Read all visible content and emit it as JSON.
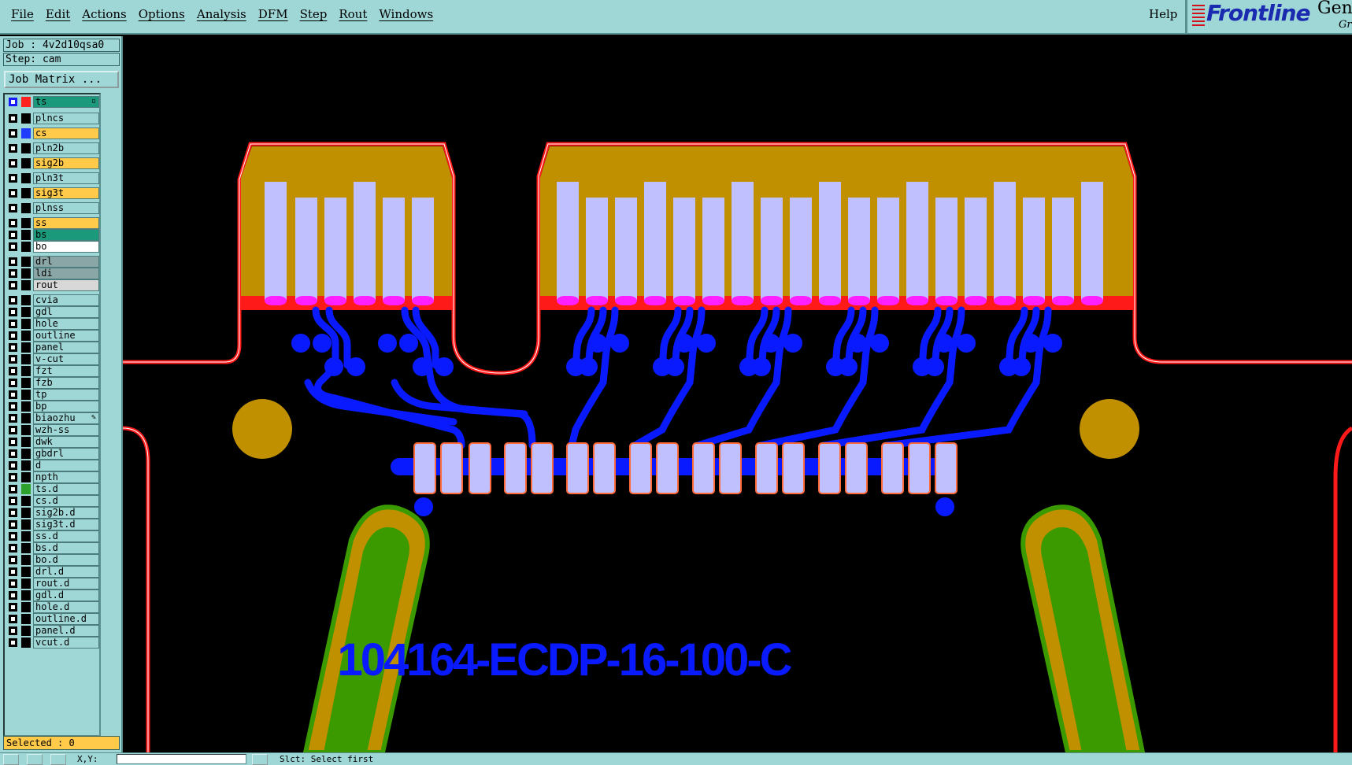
{
  "menubar": {
    "items": [
      "File",
      "Edit",
      "Actions",
      "Options",
      "Analysis",
      "DFM",
      "Step",
      "Rout",
      "Windows"
    ],
    "help": "Help",
    "brand": {
      "name": "Frontline",
      "product": "Gen",
      "sub": "Gr"
    }
  },
  "job": {
    "job_text": "Job : 4v2d10qsa0",
    "step_text": "Step: cam",
    "matrix_label": "Job Matrix ..."
  },
  "layers": [
    {
      "name": "ts",
      "bg": "#1a9a7a",
      "swatch": "#ff2020",
      "active": true,
      "mark": "▫"
    },
    {
      "name": "plncs",
      "bg": "#9fd7d7",
      "swatch": "#000000"
    },
    {
      "name": "cs",
      "bg": "#ffc94a",
      "swatch": "#1f3bff"
    },
    {
      "name": "pln2b",
      "bg": "#9fd7d7",
      "swatch": "#000000"
    },
    {
      "name": "sig2b",
      "bg": "#ffc94a",
      "swatch": "#000000"
    },
    {
      "name": "pln3t",
      "bg": "#9fd7d7",
      "swatch": "#000000"
    },
    {
      "name": "sig3t",
      "bg": "#ffc94a",
      "swatch": "#000000"
    },
    {
      "name": "plnss",
      "bg": "#9fd7d7",
      "swatch": "#000000"
    },
    {
      "name": "ss",
      "bg": "#ffc94a",
      "swatch": "#000000"
    },
    {
      "name": "bs",
      "bg": "#1a9a7a",
      "swatch": "#000000"
    },
    {
      "name": "bo",
      "bg": "#ffffff",
      "swatch": "#000000"
    },
    {
      "name": "drl",
      "bg": "#8aa6a6",
      "swatch": "#000000"
    },
    {
      "name": "ldi",
      "bg": "#8aa6a6",
      "swatch": "#000000"
    },
    {
      "name": "rout",
      "bg": "#d8d8d8",
      "swatch": "#000000"
    },
    {
      "name": "cvia",
      "bg": "#9fd7d7",
      "swatch": "#000000"
    },
    {
      "name": "gdl",
      "bg": "#9fd7d7",
      "swatch": "#000000"
    },
    {
      "name": "hole",
      "bg": "#9fd7d7",
      "swatch": "#000000"
    },
    {
      "name": "outline",
      "bg": "#9fd7d7",
      "swatch": "#000000"
    },
    {
      "name": "panel",
      "bg": "#9fd7d7",
      "swatch": "#000000"
    },
    {
      "name": "v-cut",
      "bg": "#9fd7d7",
      "swatch": "#000000"
    },
    {
      "name": "fzt",
      "bg": "#9fd7d7",
      "swatch": "#000000"
    },
    {
      "name": "fzb",
      "bg": "#9fd7d7",
      "swatch": "#000000"
    },
    {
      "name": "tp",
      "bg": "#9fd7d7",
      "swatch": "#000000"
    },
    {
      "name": "bp",
      "bg": "#9fd7d7",
      "swatch": "#000000"
    },
    {
      "name": "biaozhu",
      "bg": "#9fd7d7",
      "swatch": "#000000",
      "mark": "✎"
    },
    {
      "name": "wzh-ss",
      "bg": "#9fd7d7",
      "swatch": "#000000"
    },
    {
      "name": "dwk",
      "bg": "#9fd7d7",
      "swatch": "#000000"
    },
    {
      "name": "gbdrl",
      "bg": "#9fd7d7",
      "swatch": "#000000"
    },
    {
      "name": "d",
      "bg": "#9fd7d7",
      "swatch": "#000000"
    },
    {
      "name": "npth",
      "bg": "#9fd7d7",
      "swatch": "#000000"
    },
    {
      "name": "ts.d",
      "bg": "#9fd7d7",
      "swatch": "#2ea02e"
    },
    {
      "name": "cs.d",
      "bg": "#9fd7d7",
      "swatch": "#000000"
    },
    {
      "name": "sig2b.d",
      "bg": "#9fd7d7",
      "swatch": "#000000"
    },
    {
      "name": "sig3t.d",
      "bg": "#9fd7d7",
      "swatch": "#000000"
    },
    {
      "name": "ss.d",
      "bg": "#9fd7d7",
      "swatch": "#000000"
    },
    {
      "name": "bs.d",
      "bg": "#9fd7d7",
      "swatch": "#000000"
    },
    {
      "name": "bo.d",
      "bg": "#9fd7d7",
      "swatch": "#000000"
    },
    {
      "name": "drl.d",
      "bg": "#9fd7d7",
      "swatch": "#000000"
    },
    {
      "name": "rout.d",
      "bg": "#9fd7d7",
      "swatch": "#000000"
    },
    {
      "name": "gdl.d",
      "bg": "#9fd7d7",
      "swatch": "#000000"
    },
    {
      "name": "hole.d",
      "bg": "#9fd7d7",
      "swatch": "#000000"
    },
    {
      "name": "outline.d",
      "bg": "#9fd7d7",
      "swatch": "#000000"
    },
    {
      "name": "panel.d",
      "bg": "#9fd7d7",
      "swatch": "#000000"
    },
    {
      "name": "vcut.d",
      "bg": "#9fd7d7",
      "swatch": "#000000"
    }
  ],
  "selected_text": "Selected : 0",
  "canvas": {
    "part_label": "104164-ECDP-16-100-C",
    "colors": {
      "background": "#000000",
      "copper_pour": "#c09000",
      "finger_pad": "#c0c0ff",
      "mask_edge": "#ff1a1a",
      "finger_tip": "#ff20ff",
      "trace": "#0a1aff",
      "green_pad": "#3a9a00",
      "label": "#0a1aff"
    }
  },
  "status": {
    "xy_label": "X,Y:",
    "message": "Slct: Select first"
  }
}
